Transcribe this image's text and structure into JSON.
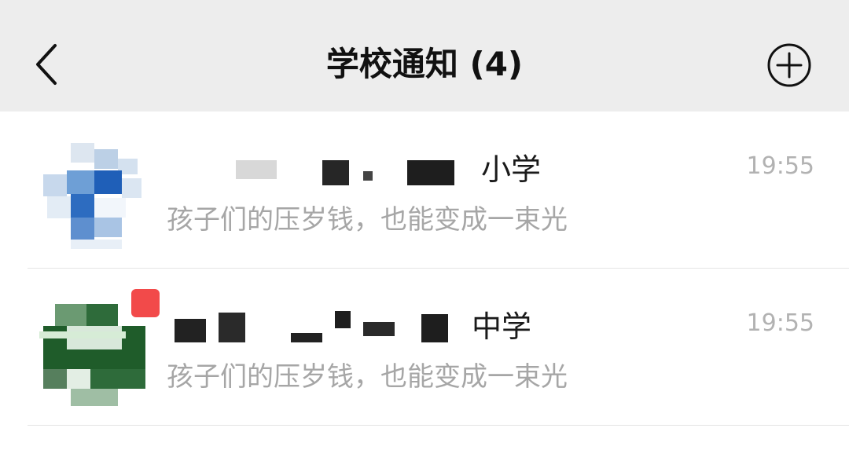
{
  "header": {
    "title": "学校通知 (4)",
    "back_icon": "chevron-left-icon",
    "add_icon": "plus-circle-icon"
  },
  "conversations": [
    {
      "name_visible_suffix": "小学",
      "time": "19:55",
      "preview": "孩子们的压岁钱，也能变成一束光",
      "unread": false,
      "avatar_colors": [
        "#1f5fb8",
        "#8bb3e0",
        "#cfdff2"
      ]
    },
    {
      "name_visible_suffix": "中学",
      "time": "19:55",
      "preview": "孩子们的压岁钱，也能变成一束光",
      "unread": true,
      "avatar_colors": [
        "#1f5c2a",
        "#6b9a72",
        "#d8e8da"
      ]
    }
  ],
  "colors": {
    "header_bg": "#ededed",
    "unread_badge": "#f24a4a",
    "time_text": "#b2b2b2",
    "preview_text": "#a6a6a6"
  }
}
